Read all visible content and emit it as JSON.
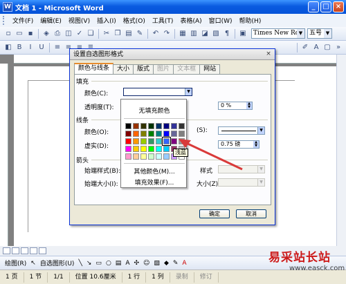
{
  "window": {
    "title": "文档 1 - Microsoft Word"
  },
  "menu": [
    "文件(F)",
    "编辑(E)",
    "视图(V)",
    "插入(I)",
    "格式(O)",
    "工具(T)",
    "表格(A)",
    "窗口(W)",
    "帮助(H)"
  ],
  "toolbar": {
    "font_name": "Times New Roma",
    "font_size": "五号"
  },
  "dialog": {
    "title": "设置自选图形格式",
    "tabs": [
      "颜色与线条",
      "大小",
      "版式",
      "图片",
      "文本框",
      "网站"
    ],
    "fill_section": "填充",
    "fill_color_label": "颜色(C):",
    "transparency_label": "透明度(T):",
    "transparency_value": "0 %",
    "line_section": "线条",
    "line_color_label": "颜色(O):",
    "line_color_suffix": "(S):",
    "dash_label": "虚实(D):",
    "weight_value": "0.75 磅",
    "arrows_section": "箭头",
    "begin_style_label": "始端样式(B):",
    "end_style_suffix": "样式",
    "begin_size_label": "始端大小(I):",
    "end_size_suffix": "大小(Z):",
    "ok": "确定",
    "cancel": "取消"
  },
  "color_popup": {
    "no_fill": "无填充颜色",
    "more_colors": "其他颜色(M)...",
    "fill_effects": "填充效果(F)...",
    "tooltip": "浅蓝",
    "swatches": [
      "#000000",
      "#993300",
      "#333300",
      "#003300",
      "#003366",
      "#000080",
      "#333399",
      "#333333",
      "#800000",
      "#ff6600",
      "#808000",
      "#008000",
      "#008080",
      "#0000ff",
      "#666699",
      "#808080",
      "#ff0000",
      "#ff9900",
      "#99cc00",
      "#339966",
      "#33cccc",
      "#3366ff",
      "#800080",
      "#969696",
      "#ff00ff",
      "#ffcc00",
      "#ffff00",
      "#00ff00",
      "#00ffff",
      "#00ccff",
      "#993366",
      "#c0c0c0",
      "#ff99cc",
      "#ffcc99",
      "#ffff99",
      "#ccffcc",
      "#ccffff",
      "#99ccff",
      "#cc99ff",
      "#ffffff"
    ],
    "selected_index": 21
  },
  "drawbar": {
    "draw_label": "绘图(R)",
    "autoshape_label": "自选图形(U)"
  },
  "status": {
    "page": "1 页",
    "section": "1 节",
    "page_of": "1/1",
    "position": "位置 10.6厘米",
    "line": "1 行",
    "col": "1 列",
    "rec": "录制",
    "trk": "修订"
  },
  "watermark": {
    "text": "易采站长站",
    "url": "www.easck.com"
  }
}
